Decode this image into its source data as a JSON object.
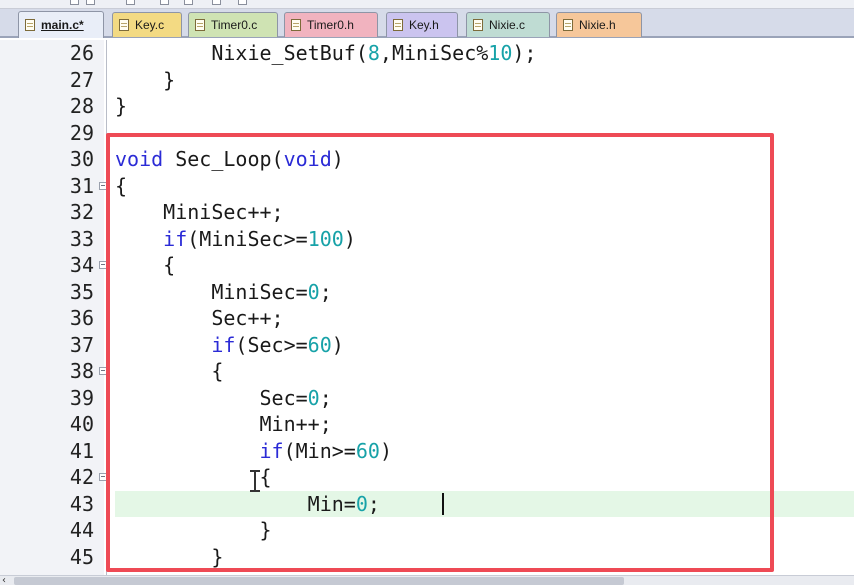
{
  "tabs": [
    {
      "label": "main.c*",
      "active": true,
      "color": "#e9eef8",
      "icon": "c-source-file-icon"
    },
    {
      "label": "Key.c",
      "active": false,
      "color": "#f3da83",
      "icon": "c-source-file-icon"
    },
    {
      "label": "Timer0.c",
      "active": false,
      "color": "#cfe3b3",
      "icon": "c-source-file-icon"
    },
    {
      "label": "Timer0.h",
      "active": false,
      "color": "#f1b3bf",
      "icon": "header-file-icon"
    },
    {
      "label": "Key.h",
      "active": false,
      "color": "#cbc4ef",
      "icon": "header-file-icon"
    },
    {
      "label": "Nixie.c",
      "active": false,
      "color": "#bfdcd3",
      "icon": "c-source-file-icon"
    },
    {
      "label": "Nixie.h",
      "active": false,
      "color": "#f6c79a",
      "icon": "header-file-icon"
    }
  ],
  "editor": {
    "lines": [
      {
        "num": "26",
        "fold": false,
        "tokens": [
          {
            "t": "        Nixie_SetBuf(",
            "c": "p"
          },
          {
            "t": "8",
            "c": "n"
          },
          {
            "t": ",MiniSec%",
            "c": "p"
          },
          {
            "t": "10",
            "c": "n"
          },
          {
            "t": ");",
            "c": "p"
          }
        ]
      },
      {
        "num": "27",
        "fold": false,
        "tokens": [
          {
            "t": "    }",
            "c": "p"
          }
        ]
      },
      {
        "num": "28",
        "fold": false,
        "tokens": [
          {
            "t": "}",
            "c": "p"
          }
        ]
      },
      {
        "num": "29",
        "fold": false,
        "tokens": []
      },
      {
        "num": "30",
        "fold": false,
        "tokens": [
          {
            "t": "void",
            "c": "k"
          },
          {
            "t": " Sec_Loop(",
            "c": "p"
          },
          {
            "t": "void",
            "c": "k"
          },
          {
            "t": ")",
            "c": "p"
          }
        ]
      },
      {
        "num": "31",
        "fold": true,
        "tokens": [
          {
            "t": "{",
            "c": "p"
          }
        ]
      },
      {
        "num": "32",
        "fold": false,
        "tokens": [
          {
            "t": "    MiniSec++;",
            "c": "p"
          }
        ]
      },
      {
        "num": "33",
        "fold": false,
        "tokens": [
          {
            "t": "    ",
            "c": "p"
          },
          {
            "t": "if",
            "c": "k"
          },
          {
            "t": "(MiniSec>=",
            "c": "p"
          },
          {
            "t": "100",
            "c": "n"
          },
          {
            "t": ")",
            "c": "p"
          }
        ]
      },
      {
        "num": "34",
        "fold": true,
        "tokens": [
          {
            "t": "    {",
            "c": "p"
          }
        ]
      },
      {
        "num": "35",
        "fold": false,
        "tokens": [
          {
            "t": "        MiniSec=",
            "c": "p"
          },
          {
            "t": "0",
            "c": "n"
          },
          {
            "t": ";",
            "c": "p"
          }
        ]
      },
      {
        "num": "36",
        "fold": false,
        "tokens": [
          {
            "t": "        Sec++;",
            "c": "p"
          }
        ]
      },
      {
        "num": "37",
        "fold": false,
        "tokens": [
          {
            "t": "        ",
            "c": "p"
          },
          {
            "t": "if",
            "c": "k"
          },
          {
            "t": "(Sec>=",
            "c": "p"
          },
          {
            "t": "60",
            "c": "n"
          },
          {
            "t": ")",
            "c": "p"
          }
        ]
      },
      {
        "num": "38",
        "fold": true,
        "tokens": [
          {
            "t": "        {",
            "c": "p"
          }
        ]
      },
      {
        "num": "39",
        "fold": false,
        "tokens": [
          {
            "t": "            Sec=",
            "c": "p"
          },
          {
            "t": "0",
            "c": "n"
          },
          {
            "t": ";",
            "c": "p"
          }
        ]
      },
      {
        "num": "40",
        "fold": false,
        "tokens": [
          {
            "t": "            Min++;",
            "c": "p"
          }
        ]
      },
      {
        "num": "41",
        "fold": false,
        "tokens": [
          {
            "t": "            ",
            "c": "p"
          },
          {
            "t": "if",
            "c": "k"
          },
          {
            "t": "(Min>=",
            "c": "p"
          },
          {
            "t": "60",
            "c": "n"
          },
          {
            "t": ")",
            "c": "p"
          }
        ]
      },
      {
        "num": "42",
        "fold": true,
        "tokens": [
          {
            "t": "            {",
            "c": "p"
          }
        ]
      },
      {
        "num": "43",
        "fold": false,
        "tokens": [
          {
            "t": "                Min=",
            "c": "p"
          },
          {
            "t": "0",
            "c": "n"
          },
          {
            "t": ";",
            "c": "p"
          }
        ]
      },
      {
        "num": "44",
        "fold": false,
        "tokens": [
          {
            "t": "            }",
            "c": "p"
          }
        ]
      },
      {
        "num": "45",
        "fold": false,
        "tokens": [
          {
            "t": "        }",
            "c": "p"
          }
        ]
      }
    ],
    "current_line": "43",
    "annotation_color": "#ee4a55",
    "current_line_color": "#e4f7e6",
    "colors": {
      "keyword": "#2b2bd6",
      "number": "#17a2a8",
      "plain": "#1a1a1a"
    }
  },
  "scrollbar": {
    "left_arrow": "‹"
  }
}
